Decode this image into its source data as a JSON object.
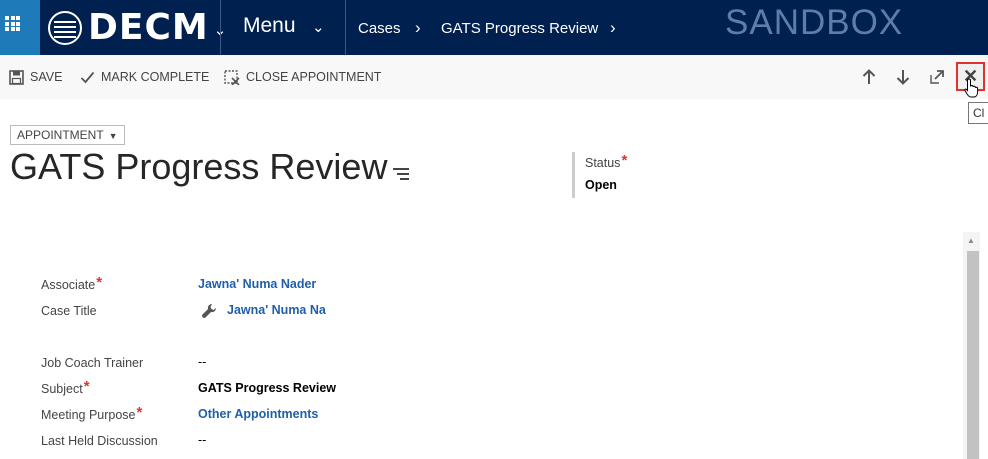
{
  "nav": {
    "brand": "DECM",
    "menu_label": "Menu",
    "breadcrumbs": [
      "Cases",
      "GATS Progress Review"
    ],
    "environment": "SANDBOX"
  },
  "commands": {
    "save": "SAVE",
    "mark_complete": "MARK COMPLETE",
    "close_appointment": "CLOSE APPOINTMENT"
  },
  "tooltip": "Cl",
  "header": {
    "entity": "APPOINTMENT",
    "title": "GATS Progress Review",
    "status_label": "Status",
    "status_value": "Open"
  },
  "fields": [
    {
      "label": "Associate",
      "value": "Jawna' Numa Nader",
      "required": true
    },
    {
      "label": "Case Title",
      "value": "Jawna' Numa Na",
      "required": false
    },
    {
      "label": "Job Coach Trainer",
      "value": "--",
      "required": false
    },
    {
      "label": "Subject",
      "value": "GATS Progress Review",
      "required": true
    },
    {
      "label": "Meeting Purpose",
      "value": "Other Appointments",
      "required": true
    },
    {
      "label": "Last Held Discussion",
      "value": "--",
      "required": false
    }
  ],
  "required_marker": "*",
  "colors": {
    "nav_bg": "#002050",
    "apps_bg": "#1e7ab8",
    "link": "#1f5fa8",
    "required": "#e0322d",
    "close_highlight": "#e0322d"
  }
}
